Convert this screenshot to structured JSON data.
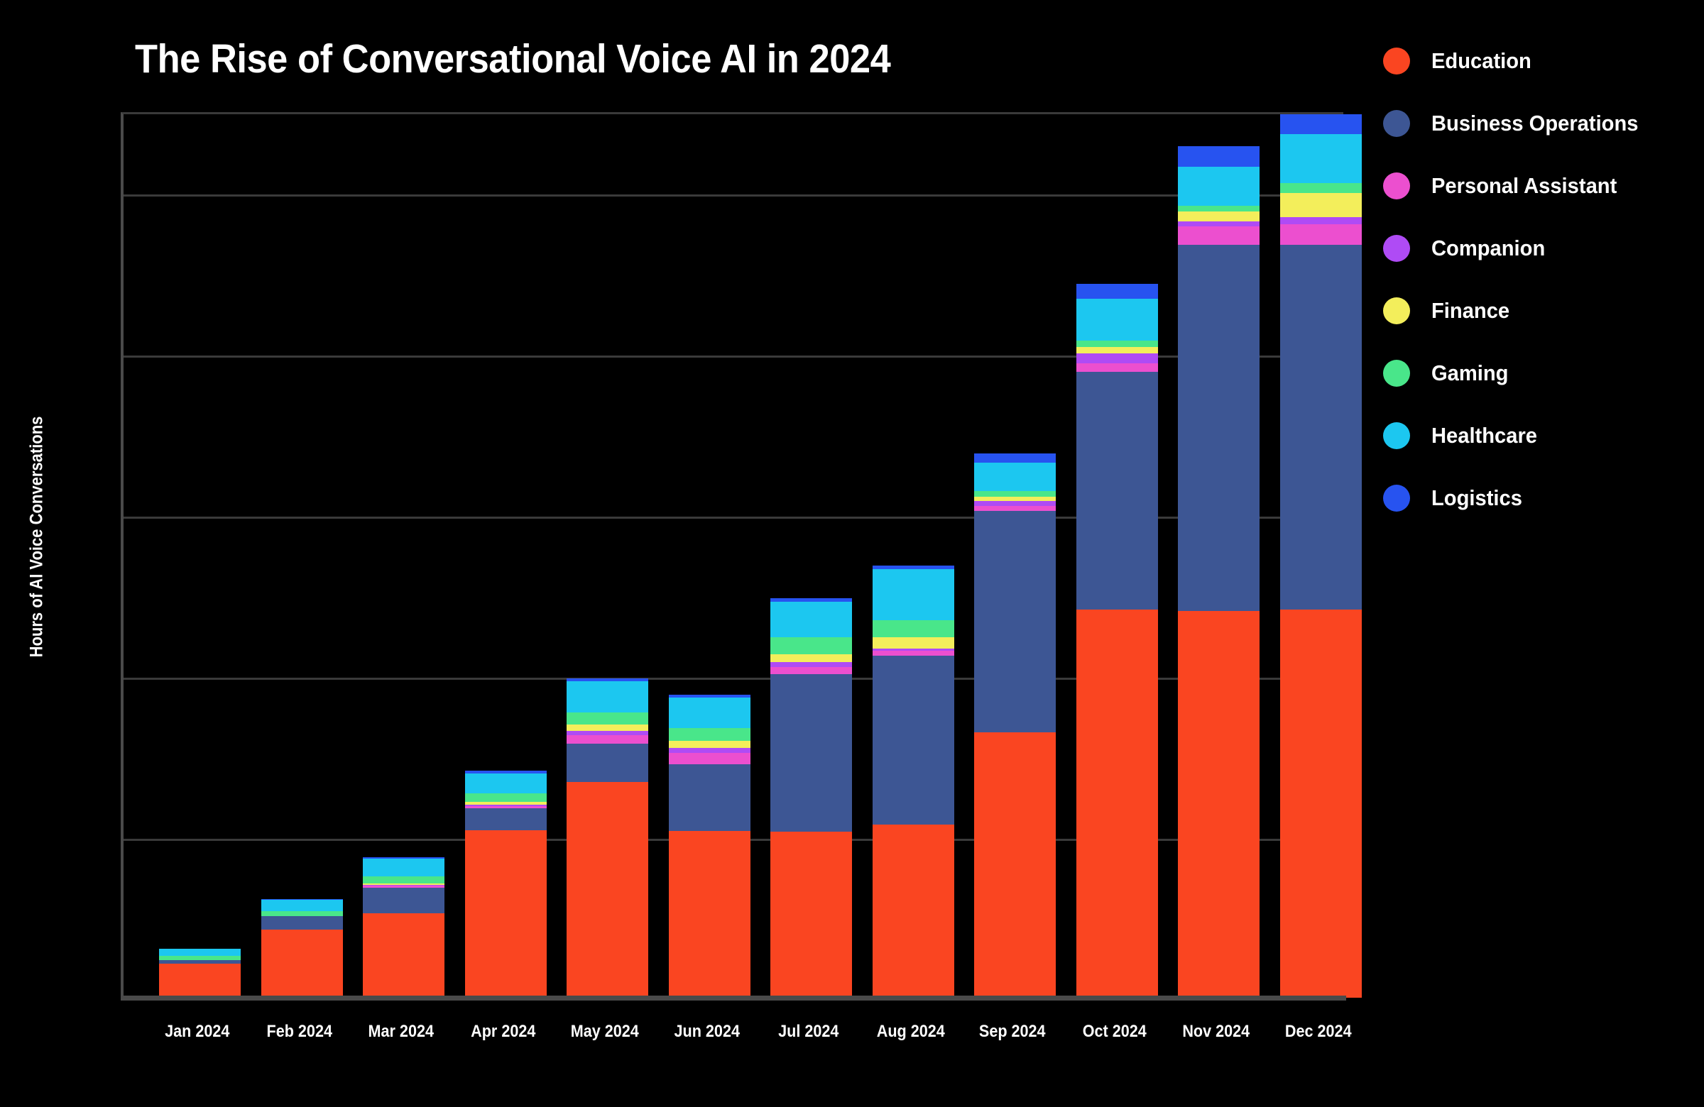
{
  "chart_data": {
    "type": "bar",
    "title": "The Rise of Conversational Voice AI in 2024",
    "xlabel": "",
    "ylabel": "Hours of AI Voice Conversations",
    "stacked": true,
    "grid": true,
    "legend_position": "right",
    "ylim": [
      0,
      1100
    ],
    "gridline_values": [
      200,
      400,
      600,
      800,
      1000
    ],
    "categories": [
      "Jan 2024",
      "Feb 2024",
      "Mar 2024",
      "Apr 2024",
      "May 2024",
      "Jun 2024",
      "Jul 2024",
      "Aug 2024",
      "Sep 2024",
      "Oct 2024",
      "Nov 2024",
      "Dec 2024"
    ],
    "series": [
      {
        "name": "Education",
        "color": "#FA4521",
        "values": [
          42,
          85,
          105,
          208,
          268,
          207,
          206,
          215,
          330,
          482,
          480,
          482
        ]
      },
      {
        "name": "Business Operations",
        "color": "#3D5694",
        "values": [
          5,
          16,
          32,
          27,
          48,
          83,
          196,
          210,
          275,
          295,
          455,
          453
        ]
      },
      {
        "name": "Personal Assistant",
        "color": "#EC4FCF",
        "values": [
          0,
          0,
          2,
          3,
          10,
          14,
          9,
          6,
          6,
          11,
          23,
          26
        ]
      },
      {
        "name": "Companion",
        "color": "#AF4BF5",
        "values": [
          0,
          0,
          1,
          2,
          5,
          6,
          6,
          3,
          6,
          12,
          6,
          9
        ]
      },
      {
        "name": "Finance",
        "color": "#F3EE5B",
        "values": [
          0,
          0,
          2,
          3,
          8,
          9,
          10,
          14,
          5,
          8,
          13,
          30
        ]
      },
      {
        "name": "Gaming",
        "color": "#49E68A",
        "values": [
          5,
          7,
          9,
          11,
          15,
          16,
          21,
          21,
          7,
          8,
          7,
          12
        ]
      },
      {
        "name": "Healthcare",
        "color": "#1CC7F0",
        "values": [
          9,
          14,
          22,
          25,
          39,
          38,
          44,
          63,
          36,
          52,
          48,
          61
        ]
      },
      {
        "name": "Logistics",
        "color": "#2753F0",
        "values": [
          0,
          1,
          2,
          3,
          4,
          3,
          4,
          5,
          11,
          19,
          26,
          24
        ]
      }
    ]
  },
  "legend": {
    "items": [
      {
        "label": "Education",
        "color": "#FA4521"
      },
      {
        "label": "Business Operations",
        "color": "#3D5694"
      },
      {
        "label": "Personal Assistant",
        "color": "#EC4FCF"
      },
      {
        "label": "Companion",
        "color": "#AF4BF5"
      },
      {
        "label": "Finance",
        "color": "#F3EE5B"
      },
      {
        "label": "Gaming",
        "color": "#49E68A"
      },
      {
        "label": "Healthcare",
        "color": "#1CC7F0"
      },
      {
        "label": "Logistics",
        "color": "#2753F0"
      }
    ]
  },
  "theme": {
    "background": "#000000",
    "text": "#FFFFFF",
    "gridline": "#3A3A3A",
    "axis": "#4A4A4A"
  }
}
